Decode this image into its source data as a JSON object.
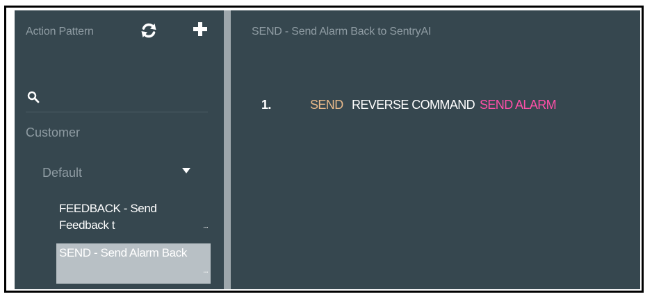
{
  "sidebar": {
    "header_title": "Action Pattern",
    "refresh_icon": "refresh-icon",
    "add_icon": "plus-icon",
    "search": {
      "icon": "search-icon",
      "placeholder": "",
      "value": ""
    },
    "customer_label": "Customer",
    "group": {
      "label": "Default",
      "icon": "caret-down-icon"
    },
    "items": [
      {
        "label": "FEEDBACK - Send Feedback t",
        "more": "...",
        "selected": false
      },
      {
        "label": "SEND - Send Alarm Back",
        "more": "...",
        "selected": true
      }
    ]
  },
  "main": {
    "title": "SEND - Send Alarm Back to SentryAI",
    "steps": [
      {
        "number": "1.",
        "tokens": [
          {
            "text": "SEND",
            "color": "#e8b98a"
          },
          {
            "text": "REVERSE COMMAND",
            "color": "#ffffff"
          },
          {
            "text": "SEND ALARM",
            "color": "#ff4fa8"
          }
        ]
      }
    ]
  },
  "colors": {
    "panel_bg": "#36474f",
    "muted_text": "#8f9ca3",
    "selected_bg": "#b8c0c5",
    "divider": "#9ea7ac"
  }
}
